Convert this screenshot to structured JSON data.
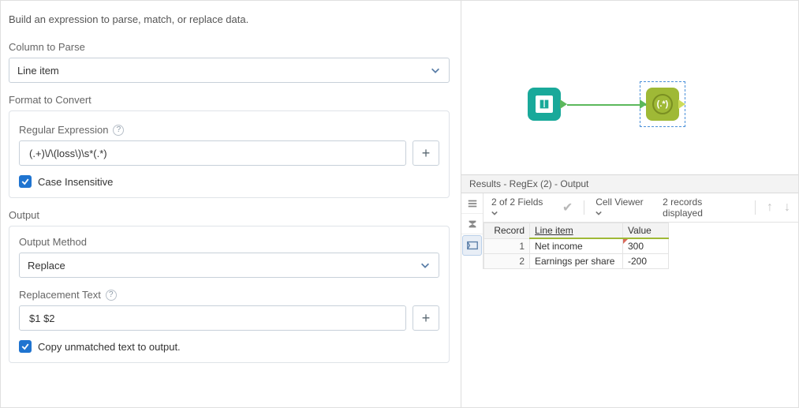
{
  "intro": "Build an expression to parse, match, or replace data.",
  "column": {
    "label": "Column to Parse",
    "value": "Line item"
  },
  "format": {
    "label": "Format to Convert",
    "regex_label": "Regular Expression",
    "regex_value": "(.+)\\/\\(loss\\)\\s*(.*)",
    "case_insensitive_label": "Case Insensitive"
  },
  "output": {
    "label": "Output",
    "method_label": "Output Method",
    "method_value": "Replace",
    "replacement_label": "Replacement Text",
    "replacement_value": "$1 $2",
    "copy_unmatched_label": "Copy unmatched text to output."
  },
  "canvas": {
    "regex_node_text": "(.*)"
  },
  "results": {
    "title": "Results - RegEx (2) - Output",
    "fields_summary": "2 of 2 Fields",
    "cell_viewer": "Cell Viewer",
    "records_summary": "2 records displayed",
    "columns": {
      "record": "Record",
      "line_item": "Line item",
      "value": "Value"
    },
    "rows": [
      {
        "record": "1",
        "line_item": "Net income",
        "value": "300"
      },
      {
        "record": "2",
        "line_item": "Earnings per share",
        "value": "-200"
      }
    ]
  }
}
